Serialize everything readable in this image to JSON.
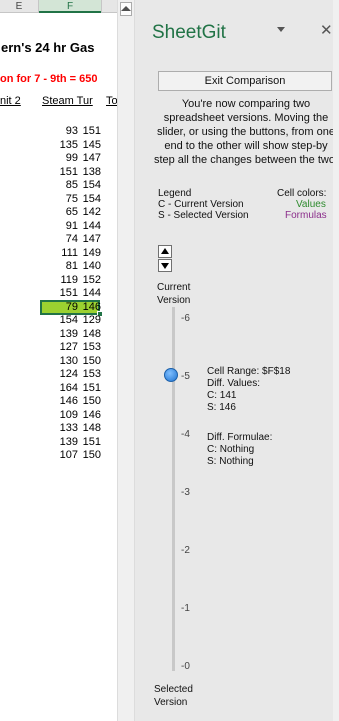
{
  "sheet": {
    "columns": [
      "E",
      "F"
    ],
    "title": "ern's 24 hr Gas",
    "subtitle": "on for 7 - 9th = 650",
    "headers": [
      "nit 2",
      "Steam Tur",
      "To"
    ],
    "rows": [
      [
        "93",
        "151"
      ],
      [
        "135",
        "145"
      ],
      [
        "99",
        "147"
      ],
      [
        "151",
        "138"
      ],
      [
        "85",
        "154"
      ],
      [
        "75",
        "154"
      ],
      [
        "65",
        "142"
      ],
      [
        "91",
        "144"
      ],
      [
        "74",
        "147"
      ],
      [
        "111",
        "149"
      ],
      [
        "81",
        "140"
      ],
      [
        "119",
        "152"
      ],
      [
        "151",
        "144"
      ],
      [
        "79",
        "146"
      ],
      [
        "154",
        "129"
      ],
      [
        "139",
        "148"
      ],
      [
        "127",
        "153"
      ],
      [
        "130",
        "150"
      ],
      [
        "124",
        "153"
      ],
      [
        "164",
        "151"
      ],
      [
        "146",
        "150"
      ],
      [
        "109",
        "146"
      ],
      [
        "133",
        "148"
      ],
      [
        "139",
        "151"
      ],
      [
        "107",
        "150"
      ]
    ],
    "highlight_color": "#9bd130"
  },
  "pane": {
    "title": "SheetGit",
    "close_icon": "close-icon",
    "menu_icon": "chevron-down-icon",
    "exit_label": "Exit Comparison",
    "description": "You're now comparing two spreadsheet versions. Moving the slider, or using the buttons, from one end to the other will show step-by step all the changes between the two.",
    "legend_label": "Legend",
    "legend_current": "C - Current Version",
    "legend_selected": "S - Selected Version",
    "cell_colors_label": "Cell colors:",
    "values_label": "Values",
    "formulas_label": "Formulas",
    "values_color": "#2e8b2e",
    "formulas_color": "#8b2e8b",
    "current_label_1": "Current",
    "current_label_2": "Version",
    "selected_label_1": "Selected",
    "selected_label_2": "Version",
    "ticks": [
      "-6",
      "-5",
      "-4",
      "-3",
      "-2",
      "-1",
      "-0"
    ],
    "slider_value": "-5",
    "info": {
      "cell_range": "Cell Range: $F$18",
      "diff_values": "Diff. Values:",
      "c_value": "C: 141",
      "s_value": "S: 146",
      "diff_formulae": "Diff. Formulae:",
      "c_formula": "C: Nothing",
      "s_formula": "S: Nothing"
    },
    "accent_color": "#217346"
  }
}
